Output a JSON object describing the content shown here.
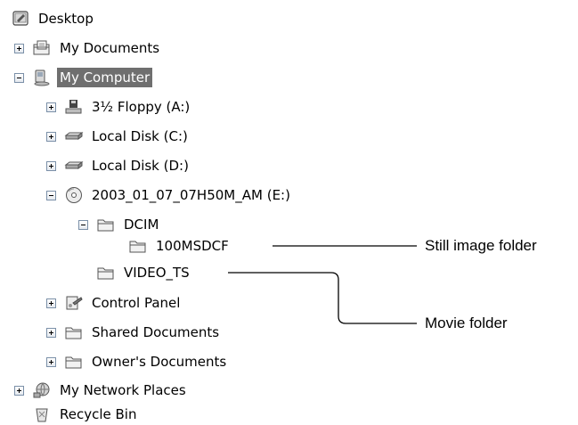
{
  "tree": {
    "desktop": "Desktop",
    "my_documents": "My Documents",
    "my_computer": "My Computer",
    "floppy": "3½ Floppy (A:)",
    "disk_c": "Local Disk (C:)",
    "disk_d": "Local Disk (D:)",
    "disc_e": "2003_01_07_07H50M_AM (E:)",
    "dcim": "DCIM",
    "msdcf": "100MSDCF",
    "video_ts": "VIDEO_TS",
    "control_panel": "Control Panel",
    "shared_docs": "Shared Documents",
    "owners_docs": "Owner's Documents",
    "network": "My Network Places",
    "recycle": "Recycle Bin"
  },
  "callouts": {
    "still": "Still image folder",
    "movie": "Movie folder"
  }
}
